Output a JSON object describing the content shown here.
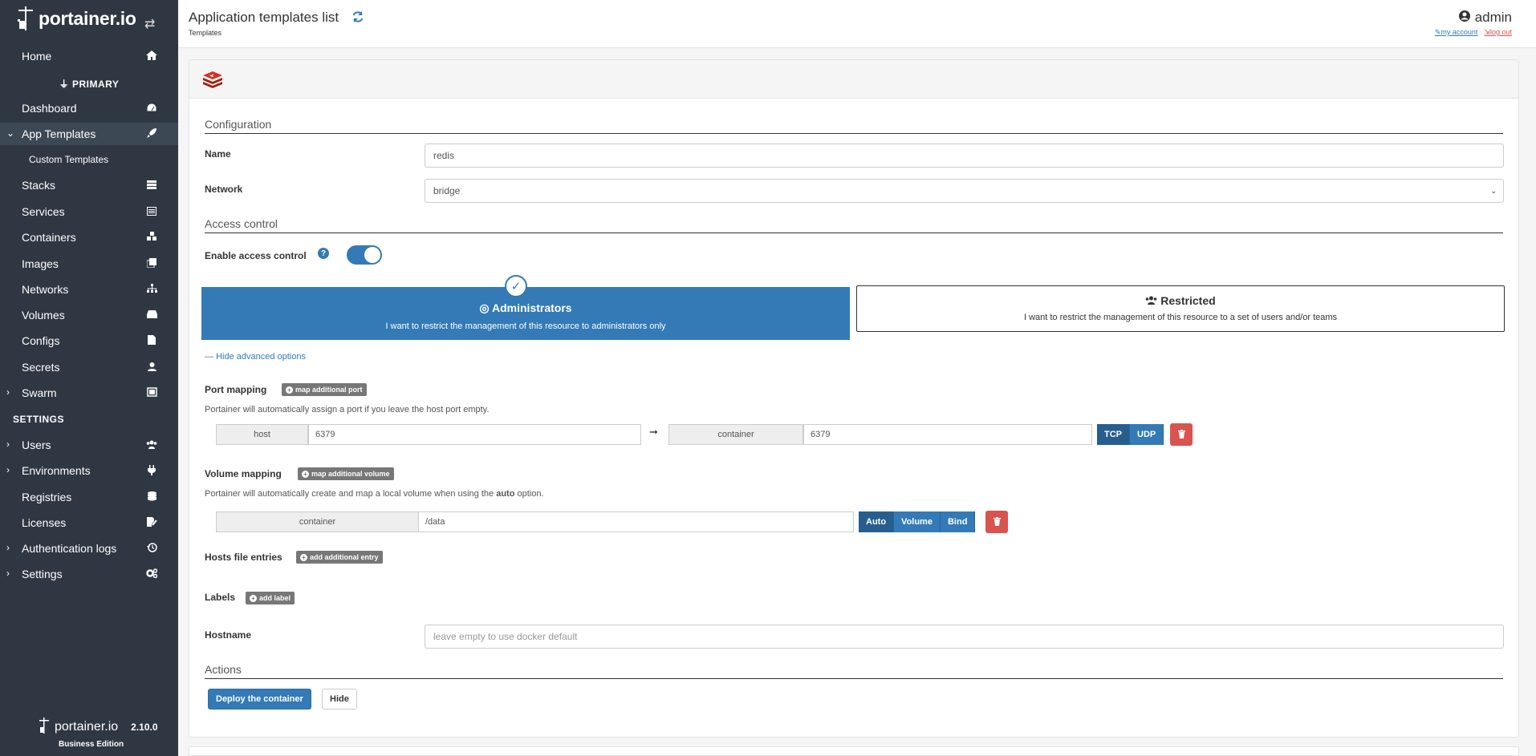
{
  "sidebar": {
    "logo_text": "portainer.io",
    "home": "Home",
    "env_name": "PRIMARY",
    "items": {
      "dashboard": "Dashboard",
      "app_templates": "App Templates",
      "custom_templates": "Custom Templates",
      "stacks": "Stacks",
      "services": "Services",
      "containers": "Containers",
      "images": "Images",
      "networks": "Networks",
      "volumes": "Volumes",
      "configs": "Configs",
      "secrets": "Secrets",
      "swarm": "Swarm"
    },
    "settings_heading": "SETTINGS",
    "settings_items": {
      "users": "Users",
      "environments": "Environments",
      "registries": "Registries",
      "licenses": "Licenses",
      "auth_logs": "Authentication logs",
      "settings": "Settings"
    },
    "footer_logo": "portainer.io",
    "version": "2.10.0",
    "edition": "Business Edition"
  },
  "header": {
    "title": "Application templates list",
    "breadcrumb": "Templates",
    "user": "admin",
    "my_account": "my account",
    "log_out": "log out"
  },
  "form": {
    "configuration_heading": "Configuration",
    "name_label": "Name",
    "name_value": "redis",
    "network_label": "Network",
    "network_value": "bridge",
    "access_heading": "Access control",
    "enable_access_label": "Enable access control",
    "admin_title": "Administrators",
    "admin_desc": "I want to restrict the management of this resource to administrators only",
    "restricted_title": "Restricted",
    "restricted_desc": "I want to restrict the management of this resource to a set of users and/or teams",
    "advanced_toggle": "Hide advanced options",
    "port_mapping_label": "Port mapping",
    "map_port_btn": "map additional port",
    "port_hint": "Portainer will automatically assign a port if you leave the host port empty.",
    "host_addon": "host",
    "host_port": "6379",
    "container_addon": "container",
    "container_port": "6379",
    "tcp": "TCP",
    "udp": "UDP",
    "volume_mapping_label": "Volume mapping",
    "map_volume_btn": "map additional volume",
    "volume_hint_pre": "Portainer will automatically create and map a local volume when using the ",
    "volume_hint_bold": "auto",
    "volume_hint_post": " option.",
    "volume_container_addon": "container",
    "volume_path": "/data",
    "auto": "Auto",
    "volume": "Volume",
    "bind": "Bind",
    "hosts_label": "Hosts file entries",
    "add_entry_btn": "add additional entry",
    "labels_label": "Labels",
    "add_label_btn": "add label",
    "hostname_label": "Hostname",
    "hostname_placeholder": "leave empty to use docker default",
    "actions_heading": "Actions",
    "deploy_btn": "Deploy the container",
    "hide_btn": "Hide"
  },
  "colors": {
    "sidebar_bg": "#2f3742",
    "primary": "#337ab7",
    "danger": "#d9534f"
  }
}
